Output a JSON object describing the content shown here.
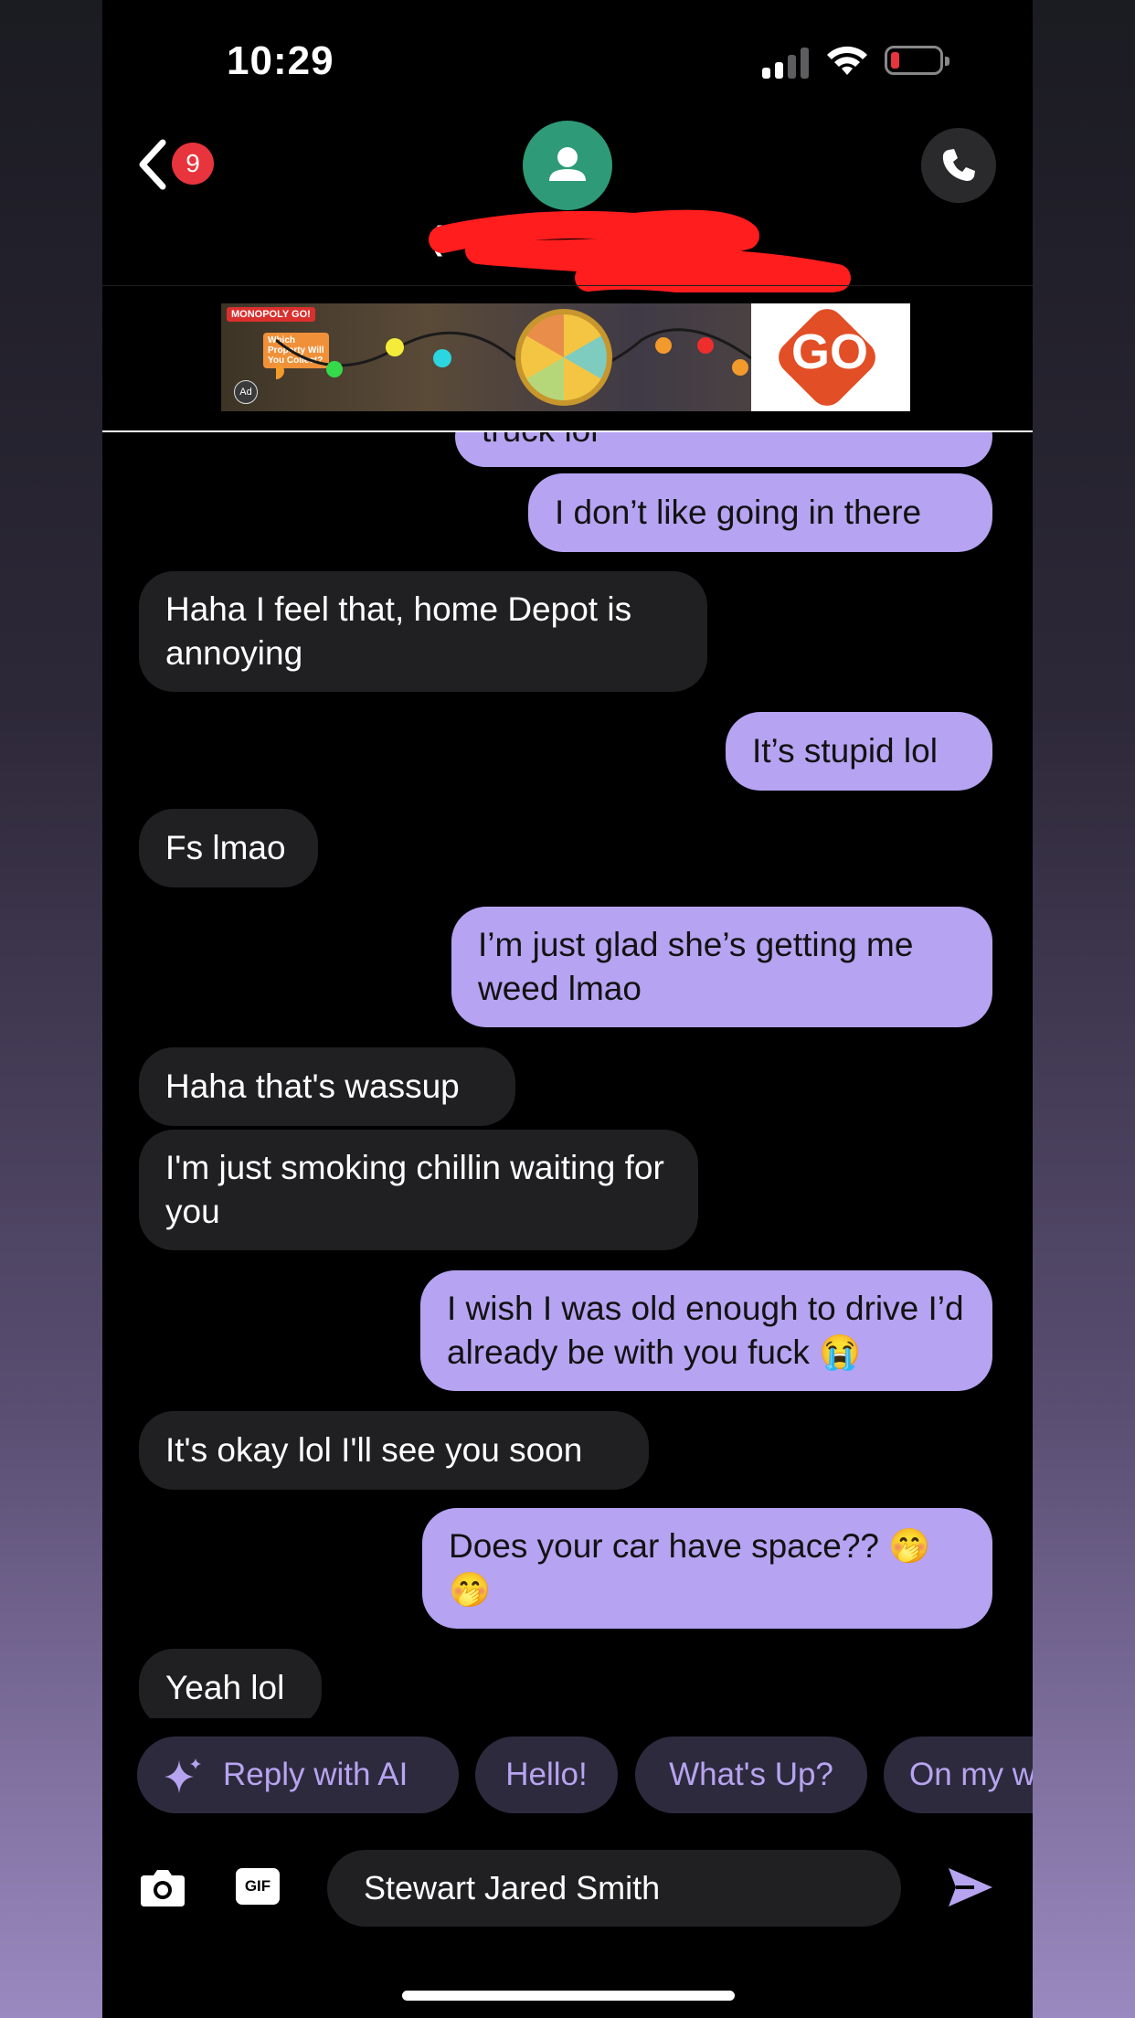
{
  "status_bar": {
    "time": "10:29"
  },
  "header": {
    "unread_count": "9",
    "contact_name": "(5"
  },
  "ad": {
    "brand": "MONOPOLY GO!",
    "note": "Which Property Will You Collect?",
    "label": "Ad",
    "cta": "GO"
  },
  "messages": [
    {
      "dir": "out",
      "text": "truck lol"
    },
    {
      "dir": "out",
      "text": "I don’t like going in there"
    },
    {
      "dir": "in",
      "text": "Haha I feel that, home Depot is annoying"
    },
    {
      "dir": "out",
      "text": "It’s stupid lol"
    },
    {
      "dir": "in",
      "text": "Fs lmao"
    },
    {
      "dir": "out",
      "text": "I’m just glad she’s getting me weed lmao"
    },
    {
      "dir": "in",
      "text": "Haha that's wassup"
    },
    {
      "dir": "in",
      "text": "I'm just smoking chillin waiting for you"
    },
    {
      "dir": "out",
      "text": "I wish I was old enough to drive I’d already be with you fuck 😭"
    },
    {
      "dir": "in",
      "text": "It's okay lol I'll see you soon"
    },
    {
      "dir": "out",
      "text": "Does your car have space?? 🤭 🤭"
    },
    {
      "dir": "in",
      "text": "Yeah lol"
    }
  ],
  "suggestions": {
    "ai_label": "Reply with AI",
    "chips": [
      "Hello!",
      "What's Up?",
      "On my way"
    ]
  },
  "composer": {
    "value": "Stewart Jared Smith",
    "gif_label": "GIF"
  },
  "colors": {
    "outgoing": "#b6a3f2",
    "incoming": "#202022",
    "accent": "#b7a4f0",
    "badge": "#e8343d",
    "avatar": "#2e9a78"
  }
}
